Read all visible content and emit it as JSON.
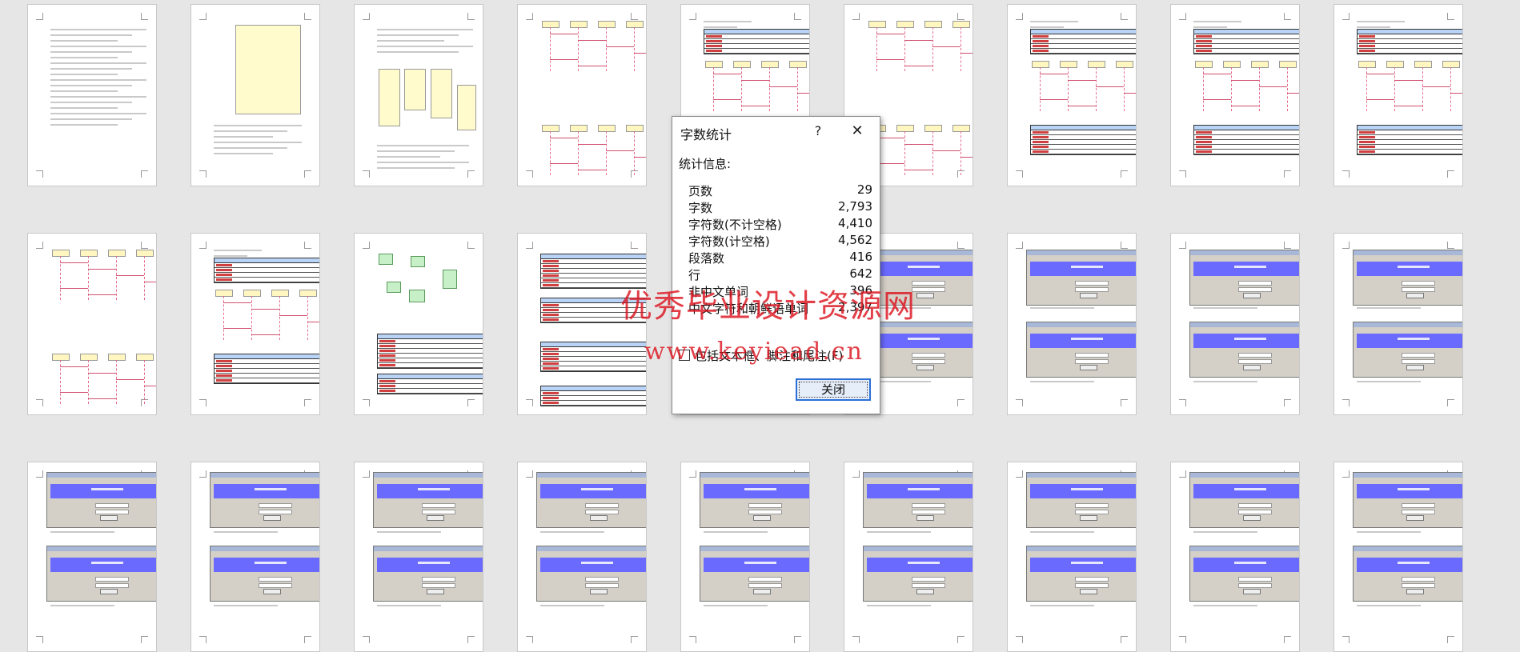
{
  "dialog": {
    "title": "字数统计",
    "help_glyph": "?",
    "close_glyph": "✕",
    "section_label": "统计信息:",
    "stats": [
      {
        "label": "页数",
        "value": "29"
      },
      {
        "label": "字数",
        "value": "2,793"
      },
      {
        "label": "字符数(不计空格)",
        "value": "4,410"
      },
      {
        "label": "字符数(计空格)",
        "value": "4,562"
      },
      {
        "label": "段落数",
        "value": "416"
      },
      {
        "label": "行",
        "value": "642"
      },
      {
        "label": "非中文单词",
        "value": "396"
      },
      {
        "label": "中文字符和朝鲜语单词",
        "value": "2,397"
      }
    ],
    "include_textboxes_label": "包括文本框、脚注和尾注(F)",
    "include_textboxes_checked": false,
    "close_button": "关闭"
  },
  "watermark": {
    "line1": "优秀毕业设计资源网",
    "line2": "www.keyiead.cn"
  },
  "thumbnails": {
    "page_count_visible": 27,
    "page_types": [
      "text-cover",
      "usecase",
      "classes",
      "sequence",
      "sequence-table",
      "sequence",
      "sequence-table",
      "sequence-table",
      "sequence-table",
      "sequence",
      "sequence-table",
      "class-graph",
      "tables",
      "ui-shot",
      "ui-shot",
      "ui-shot",
      "ui-shot",
      "ui-shot",
      "ui-shot",
      "ui-shot",
      "ui-shot",
      "ui-shot",
      "ui-shot",
      "ui-shot",
      "ui-shot",
      "ui-shot",
      "ui-shot"
    ]
  }
}
